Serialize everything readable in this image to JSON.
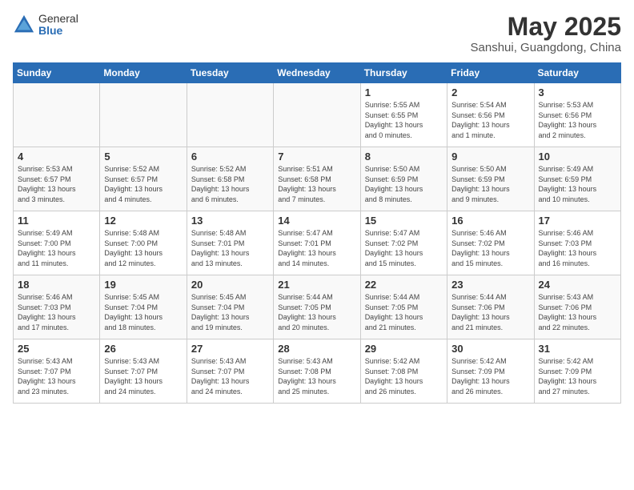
{
  "logo": {
    "general": "General",
    "blue": "Blue"
  },
  "title": "May 2025",
  "location": "Sanshui, Guangdong, China",
  "weekdays": [
    "Sunday",
    "Monday",
    "Tuesday",
    "Wednesday",
    "Thursday",
    "Friday",
    "Saturday"
  ],
  "weeks": [
    [
      {
        "day": "",
        "empty": true
      },
      {
        "day": "",
        "empty": true
      },
      {
        "day": "",
        "empty": true
      },
      {
        "day": "",
        "empty": true
      },
      {
        "day": "1",
        "info": "Sunrise: 5:55 AM\nSunset: 6:55 PM\nDaylight: 13 hours\nand 0 minutes."
      },
      {
        "day": "2",
        "info": "Sunrise: 5:54 AM\nSunset: 6:56 PM\nDaylight: 13 hours\nand 1 minute."
      },
      {
        "day": "3",
        "info": "Sunrise: 5:53 AM\nSunset: 6:56 PM\nDaylight: 13 hours\nand 2 minutes."
      }
    ],
    [
      {
        "day": "4",
        "info": "Sunrise: 5:53 AM\nSunset: 6:57 PM\nDaylight: 13 hours\nand 3 minutes."
      },
      {
        "day": "5",
        "info": "Sunrise: 5:52 AM\nSunset: 6:57 PM\nDaylight: 13 hours\nand 4 minutes."
      },
      {
        "day": "6",
        "info": "Sunrise: 5:52 AM\nSunset: 6:58 PM\nDaylight: 13 hours\nand 6 minutes."
      },
      {
        "day": "7",
        "info": "Sunrise: 5:51 AM\nSunset: 6:58 PM\nDaylight: 13 hours\nand 7 minutes."
      },
      {
        "day": "8",
        "info": "Sunrise: 5:50 AM\nSunset: 6:59 PM\nDaylight: 13 hours\nand 8 minutes."
      },
      {
        "day": "9",
        "info": "Sunrise: 5:50 AM\nSunset: 6:59 PM\nDaylight: 13 hours\nand 9 minutes."
      },
      {
        "day": "10",
        "info": "Sunrise: 5:49 AM\nSunset: 6:59 PM\nDaylight: 13 hours\nand 10 minutes."
      }
    ],
    [
      {
        "day": "11",
        "info": "Sunrise: 5:49 AM\nSunset: 7:00 PM\nDaylight: 13 hours\nand 11 minutes."
      },
      {
        "day": "12",
        "info": "Sunrise: 5:48 AM\nSunset: 7:00 PM\nDaylight: 13 hours\nand 12 minutes."
      },
      {
        "day": "13",
        "info": "Sunrise: 5:48 AM\nSunset: 7:01 PM\nDaylight: 13 hours\nand 13 minutes."
      },
      {
        "day": "14",
        "info": "Sunrise: 5:47 AM\nSunset: 7:01 PM\nDaylight: 13 hours\nand 14 minutes."
      },
      {
        "day": "15",
        "info": "Sunrise: 5:47 AM\nSunset: 7:02 PM\nDaylight: 13 hours\nand 15 minutes."
      },
      {
        "day": "16",
        "info": "Sunrise: 5:46 AM\nSunset: 7:02 PM\nDaylight: 13 hours\nand 15 minutes."
      },
      {
        "day": "17",
        "info": "Sunrise: 5:46 AM\nSunset: 7:03 PM\nDaylight: 13 hours\nand 16 minutes."
      }
    ],
    [
      {
        "day": "18",
        "info": "Sunrise: 5:46 AM\nSunset: 7:03 PM\nDaylight: 13 hours\nand 17 minutes."
      },
      {
        "day": "19",
        "info": "Sunrise: 5:45 AM\nSunset: 7:04 PM\nDaylight: 13 hours\nand 18 minutes."
      },
      {
        "day": "20",
        "info": "Sunrise: 5:45 AM\nSunset: 7:04 PM\nDaylight: 13 hours\nand 19 minutes."
      },
      {
        "day": "21",
        "info": "Sunrise: 5:44 AM\nSunset: 7:05 PM\nDaylight: 13 hours\nand 20 minutes."
      },
      {
        "day": "22",
        "info": "Sunrise: 5:44 AM\nSunset: 7:05 PM\nDaylight: 13 hours\nand 21 minutes."
      },
      {
        "day": "23",
        "info": "Sunrise: 5:44 AM\nSunset: 7:06 PM\nDaylight: 13 hours\nand 21 minutes."
      },
      {
        "day": "24",
        "info": "Sunrise: 5:43 AM\nSunset: 7:06 PM\nDaylight: 13 hours\nand 22 minutes."
      }
    ],
    [
      {
        "day": "25",
        "info": "Sunrise: 5:43 AM\nSunset: 7:07 PM\nDaylight: 13 hours\nand 23 minutes."
      },
      {
        "day": "26",
        "info": "Sunrise: 5:43 AM\nSunset: 7:07 PM\nDaylight: 13 hours\nand 24 minutes."
      },
      {
        "day": "27",
        "info": "Sunrise: 5:43 AM\nSunset: 7:07 PM\nDaylight: 13 hours\nand 24 minutes."
      },
      {
        "day": "28",
        "info": "Sunrise: 5:43 AM\nSunset: 7:08 PM\nDaylight: 13 hours\nand 25 minutes."
      },
      {
        "day": "29",
        "info": "Sunrise: 5:42 AM\nSunset: 7:08 PM\nDaylight: 13 hours\nand 26 minutes."
      },
      {
        "day": "30",
        "info": "Sunrise: 5:42 AM\nSunset: 7:09 PM\nDaylight: 13 hours\nand 26 minutes."
      },
      {
        "day": "31",
        "info": "Sunrise: 5:42 AM\nSunset: 7:09 PM\nDaylight: 13 hours\nand 27 minutes."
      }
    ]
  ]
}
